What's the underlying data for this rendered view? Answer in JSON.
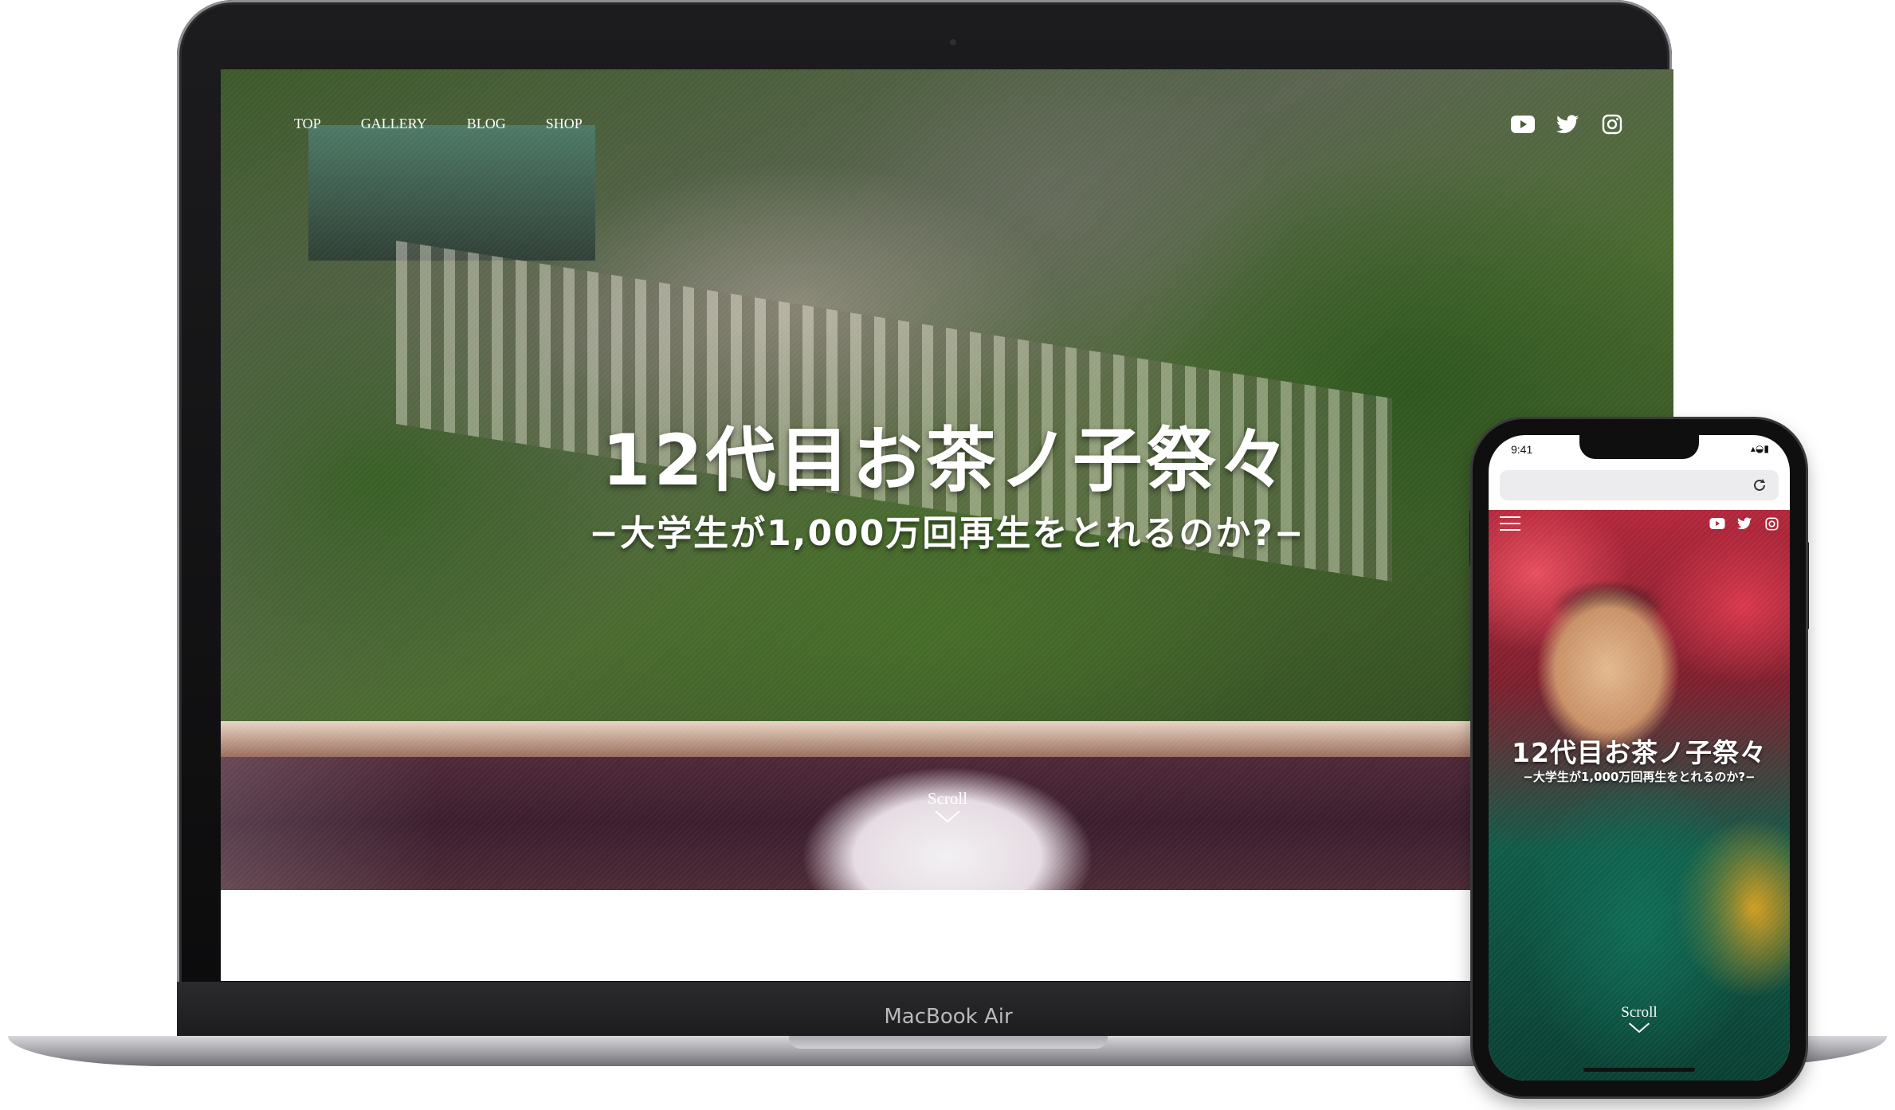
{
  "laptop": {
    "model_label": "MacBook Air",
    "nav": [
      {
        "label": "TOP"
      },
      {
        "label": "GALLERY"
      },
      {
        "label": "BLOG"
      },
      {
        "label": "SHOP"
      }
    ],
    "social_icons": [
      "youtube-icon",
      "twitter-icon",
      "instagram-icon"
    ],
    "hero": {
      "title": "12代目お茶ノ子祭々",
      "subtitle": "−大学生が1,000万回再生をとれるのか?−",
      "scroll_label": "Scroll"
    }
  },
  "phone": {
    "status_time": "9:41",
    "status_right": "▴◒▮",
    "url_bar_icon": "reload-icon",
    "menu_icon": "hamburger-menu-icon",
    "social_icons": [
      "youtube-icon",
      "twitter-icon",
      "instagram-icon"
    ],
    "hero": {
      "title": "12代目お茶ノ子祭々",
      "subtitle": "−大学生が1,000万回再生をとれるのか?−",
      "scroll_label": "Scroll"
    }
  },
  "colors": {
    "text_on_hero": "#ffffff",
    "device_frame": "#0f0f10"
  }
}
